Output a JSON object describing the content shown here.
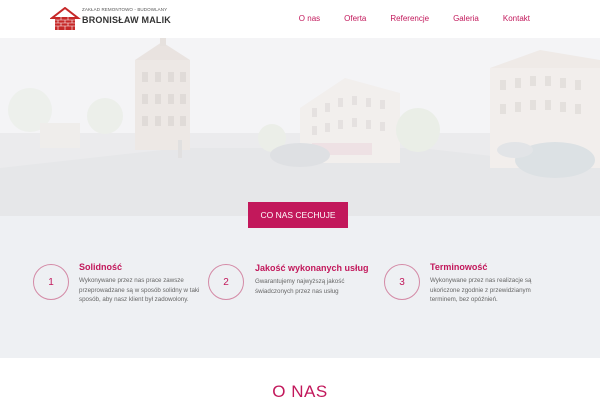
{
  "brand": {
    "tagline": "ZAKŁAD REMONTOWO - BUDOWLANY",
    "name": "BRONISŁAW MALIK"
  },
  "nav": {
    "items": [
      "O nas",
      "Oferta",
      "Referencje",
      "Galeria",
      "Kontakt"
    ]
  },
  "hero": {
    "cta_label": "CO NAS CECHUJE"
  },
  "features": [
    {
      "number": "1",
      "title": "Solidność",
      "description": "Wykonywane przez nas prace zawsze przeprowadzane są w sposób solidny w taki sposób, aby nasz klient był zadowolony."
    },
    {
      "number": "2",
      "title": "Jakość wykonanych usług",
      "description": "Gwarantujemy najwyższą jakość świadczonych przez nas usług"
    },
    {
      "number": "3",
      "title": "Terminowość",
      "description": "Wykonywane przez nas realizacje są ukończone zgodnie z przewidzianym terminem, bez opóźnień."
    }
  ],
  "section": {
    "title": "O NAS"
  },
  "colors": {
    "accent": "#c2185b",
    "strip": "#eef0f3"
  }
}
